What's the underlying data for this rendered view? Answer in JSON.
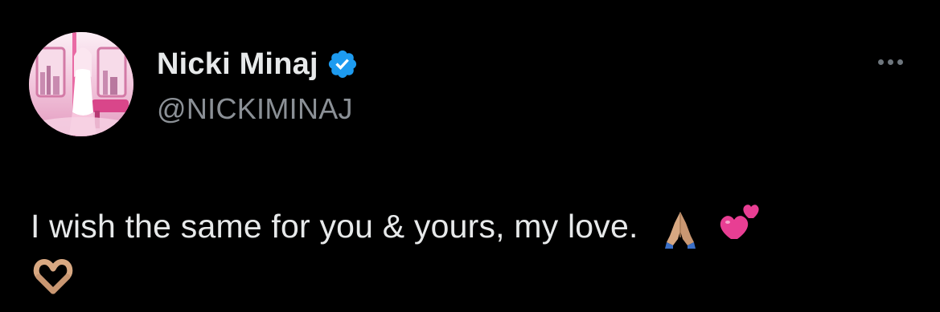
{
  "tweet": {
    "author": {
      "display_name": "Nicki Minaj",
      "handle": "@NICKIMINAJ",
      "verified": true
    },
    "text": "I wish the same for you & yours, my love.",
    "emojis": [
      "folded-hands-icon",
      "two-hearts-icon",
      "heart-hands-icon"
    ]
  },
  "icons": {
    "verified": "verified-badge-icon",
    "more": "more-options-icon"
  },
  "colors": {
    "background": "#000000",
    "primary_text": "#e7e9ea",
    "secondary_text": "#8b9096",
    "verified_blue": "#1d9bf0"
  }
}
